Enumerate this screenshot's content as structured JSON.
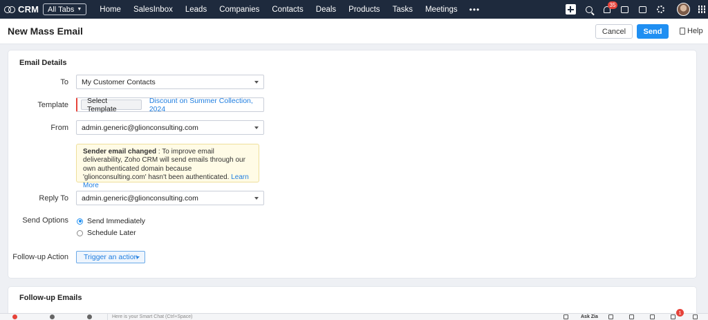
{
  "app": {
    "name": "CRM",
    "all_tabs_label": "All Tabs"
  },
  "nav": {
    "items": [
      "Home",
      "SalesInbox",
      "Leads",
      "Companies",
      "Contacts",
      "Deals",
      "Products",
      "Tasks",
      "Meetings"
    ],
    "more": "•••",
    "notification_count": "35"
  },
  "header": {
    "title": "New Mass Email",
    "cancel_label": "Cancel",
    "send_label": "Send",
    "help_label": "Help"
  },
  "email_details": {
    "section_title": "Email Details",
    "to_label": "To",
    "to_value": "My Customer Contacts",
    "template_label": "Template",
    "select_template_label": "Select Template",
    "template_value": "Discount on Summer Collection, 2024",
    "from_label": "From",
    "from_value": "admin.generic@glionconsulting.com",
    "notice_title": "Sender email changed",
    "notice_text": " : To improve email deliverability, Zoho CRM will send emails through our own authenticated domain because 'glionconsulting.com' hasn't been authenticated. ",
    "notice_link": "Learn More",
    "reply_to_label": "Reply To",
    "reply_to_value": "admin.generic@glionconsulting.com",
    "send_options_label": "Send Options",
    "send_immediately": "Send Immediately",
    "schedule_later": "Schedule Later",
    "followup_action_label": "Follow-up Action",
    "trigger_action_label": "Trigger an action"
  },
  "followup": {
    "section_title": "Follow-up Emails"
  },
  "bottom_bar": {
    "chat_placeholder": "Here is your Smart Chat (Ctrl+Space)",
    "ask_zia": "Ask Zia",
    "alert_count": "1"
  }
}
